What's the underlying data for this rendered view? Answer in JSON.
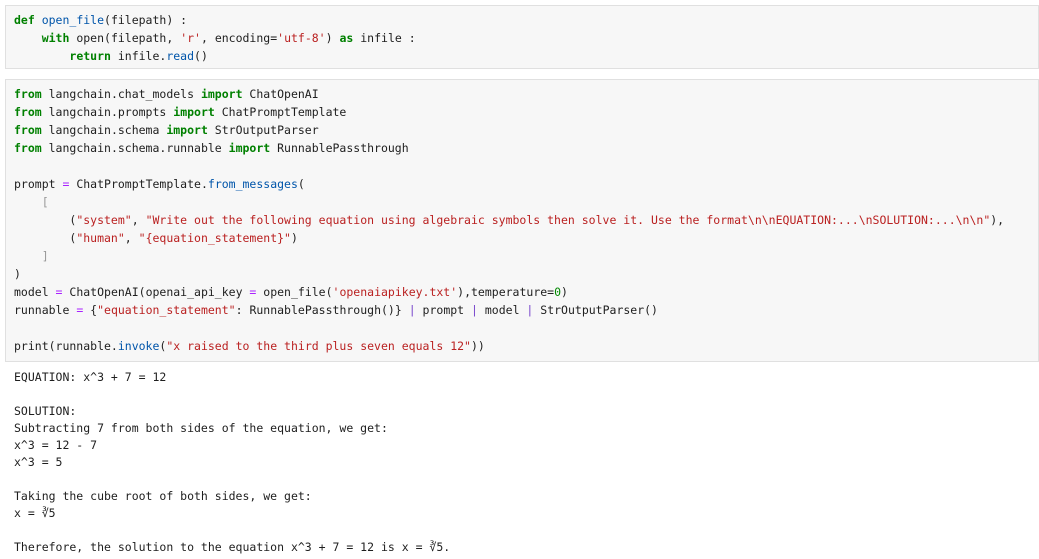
{
  "cell1": {
    "lines": [
      [
        "def ",
        "open_file",
        "(filepath) :"
      ],
      [
        "    ",
        "with",
        " open(filepath, ",
        "'r'",
        ", encoding=",
        "'utf-8'",
        ") ",
        "as",
        " infile :"
      ],
      [
        "        ",
        "return",
        " infile.",
        "read",
        "()"
      ]
    ]
  },
  "cell2": {
    "lines": [
      [
        "from",
        " langchain.chat_models ",
        "import",
        " ChatOpenAI"
      ],
      [
        "from",
        " langchain.prompts ",
        "import",
        " ChatPromptTemplate"
      ],
      [
        "from",
        " langchain.schema ",
        "import",
        " StrOutputParser"
      ],
      [
        "from",
        " langchain.schema.runnable ",
        "import",
        " RunnablePassthrough"
      ],
      [
        ""
      ],
      [
        "prompt ",
        "=",
        " ChatPromptTemplate.",
        "from_messages",
        "("
      ],
      [
        "    ",
        "["
      ],
      [
        "        (",
        "\"system\"",
        ", ",
        "\"Write out the following equation using algebraic symbols then solve it. Use the format\\n\\nEQUATION:...\\nSOLUTION:...\\n\\n\"",
        "),"
      ],
      [
        "        (",
        "\"human\"",
        ", ",
        "\"{equation_statement}\"",
        ")"
      ],
      [
        "    ",
        "]"
      ],
      [
        ")"
      ],
      [
        "model ",
        "=",
        " ChatOpenAI(openai_api_key ",
        "=",
        " open_file(",
        "'openaiapikey.txt'",
        "),temperature=",
        "0",
        ")"
      ],
      [
        "runnable ",
        "=",
        " {",
        "\"equation_statement\"",
        ": RunnablePassthrough()} ",
        "|",
        " prompt ",
        "|",
        " model ",
        "|",
        " StrOutputParser()"
      ],
      [
        ""
      ],
      [
        "print(runnable.",
        "invoke",
        "(",
        "\"x raised to the third plus seven equals 12\"",
        "))"
      ]
    ]
  },
  "output": {
    "lines": [
      "EQUATION: x^3 + 7 = 12",
      "",
      "SOLUTION:",
      "Subtracting 7 from both sides of the equation, we get:",
      "x^3 = 12 - 7",
      "x^3 = 5",
      "",
      "Taking the cube root of both sides, we get:",
      "x = ∛5",
      "",
      "Therefore, the solution to the equation x^3 + 7 = 12 is x = ∛5."
    ]
  }
}
